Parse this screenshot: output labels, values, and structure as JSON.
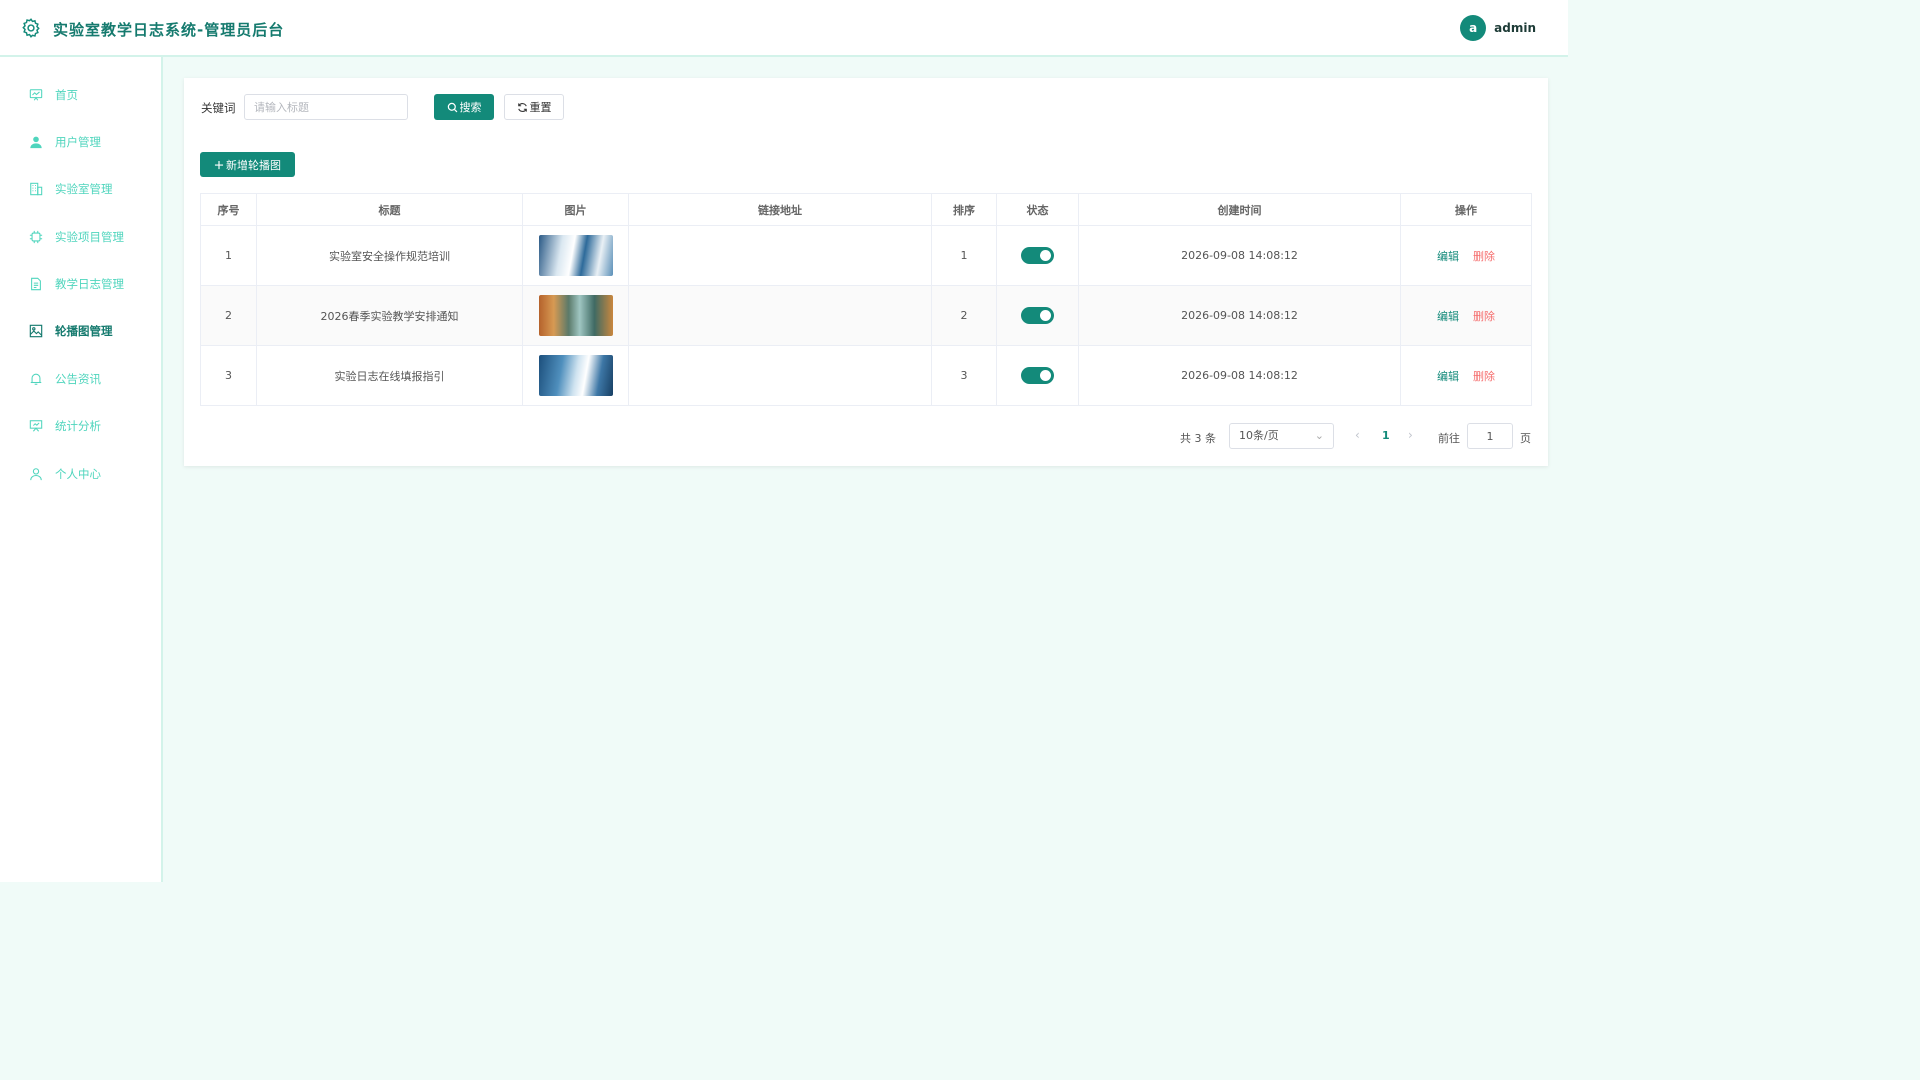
{
  "header": {
    "title": "实验室教学日志系统-管理员后台",
    "avatar_letter": "a",
    "username": "admin"
  },
  "sidebar": {
    "items": [
      {
        "label": "首页",
        "icon": "monitor-chart-icon",
        "active": false
      },
      {
        "label": "用户管理",
        "icon": "user-icon",
        "active": false
      },
      {
        "label": "实验室管理",
        "icon": "building-icon",
        "active": false
      },
      {
        "label": "实验项目管理",
        "icon": "chip-icon",
        "active": false
      },
      {
        "label": "教学日志管理",
        "icon": "document-icon",
        "active": false
      },
      {
        "label": "轮播图管理",
        "icon": "image-icon",
        "active": true
      },
      {
        "label": "公告资讯",
        "icon": "bell-icon",
        "active": false
      },
      {
        "label": "统计分析",
        "icon": "presentation-icon",
        "active": false
      },
      {
        "label": "个人中心",
        "icon": "person-outline-icon",
        "active": false
      }
    ]
  },
  "search": {
    "label": "关键词",
    "placeholder": "请输入标题",
    "value": "",
    "search_button": "搜索",
    "reset_button": "重置"
  },
  "toolbar": {
    "add_button": "新增轮播图"
  },
  "table": {
    "columns": [
      "序号",
      "标题",
      "图片",
      "链接地址",
      "排序",
      "状态",
      "创建时间",
      "操作"
    ],
    "rows": [
      {
        "index": "1",
        "title": "实验室安全操作规范培训",
        "link": "",
        "sort": "1",
        "enabled": true,
        "created": "2026-09-08 14:08:12",
        "edit": "编辑",
        "delete": "删除"
      },
      {
        "index": "2",
        "title": "2026春季实验教学安排通知",
        "link": "",
        "sort": "2",
        "enabled": true,
        "created": "2026-09-08 14:08:12",
        "edit": "编辑",
        "delete": "删除"
      },
      {
        "index": "3",
        "title": "实验日志在线填报指引",
        "link": "",
        "sort": "3",
        "enabled": true,
        "created": "2026-09-08 14:08:12",
        "edit": "编辑",
        "delete": "删除"
      }
    ]
  },
  "pagination": {
    "total_text": "共 3 条",
    "page_size": "10条/页",
    "current_page": "1",
    "goto_label": "前往",
    "goto_value": "1",
    "page_unit": "页"
  },
  "colors": {
    "primary": "#138a7a",
    "nav_text": "#4fd5bd",
    "danger": "#f56c6c",
    "background": "#f0fbf8"
  }
}
